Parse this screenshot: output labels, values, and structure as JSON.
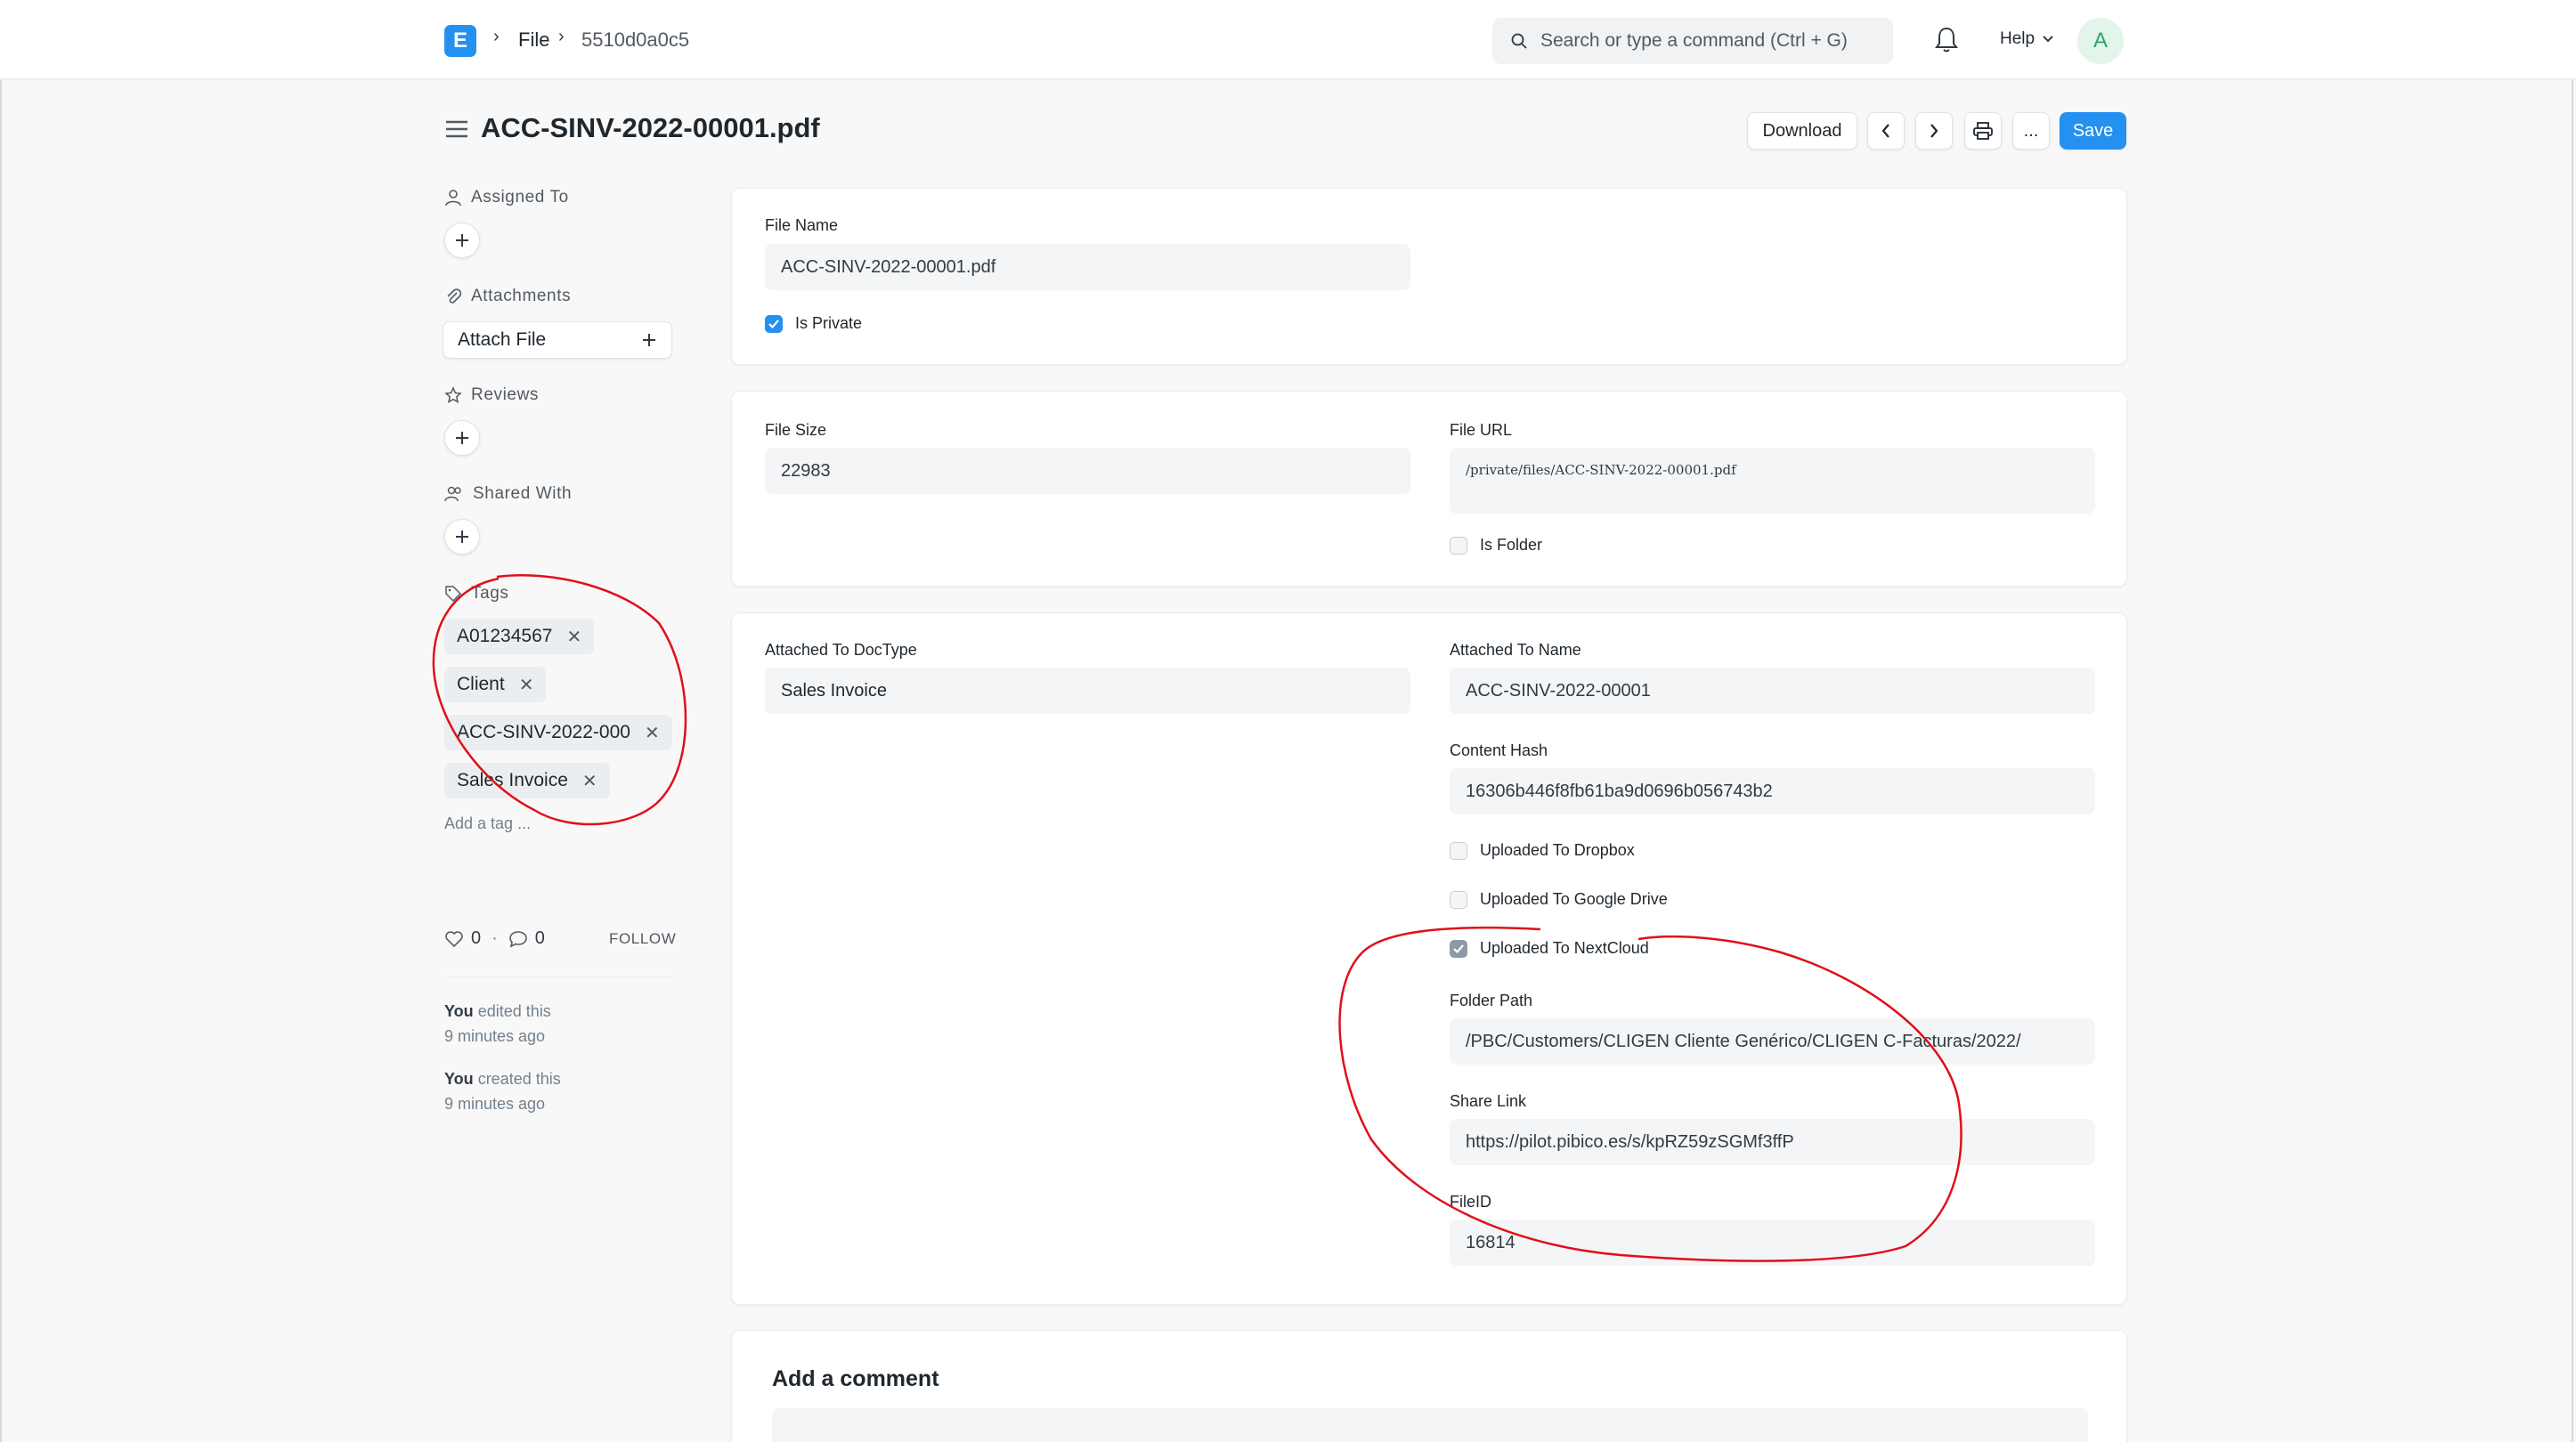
{
  "navbar": {
    "logo_letter": "E",
    "breadcrumbs": [
      "File",
      "5510d0a0c5"
    ],
    "search_placeholder": "Search or type a command (Ctrl + G)",
    "help_label": "Help",
    "avatar_initial": "A"
  },
  "page": {
    "title": "ACC-SINV-2022-00001.pdf",
    "actions": {
      "download_label": "Download",
      "more_label": "...",
      "save_label": "Save"
    }
  },
  "sidebar": {
    "assigned_to_label": "Assigned To",
    "attachments_label": "Attachments",
    "attach_file_label": "Attach File",
    "reviews_label": "Reviews",
    "shared_with_label": "Shared With",
    "tags_label": "Tags",
    "tags": [
      "A01234567",
      "Client",
      "ACC-SINV-2022-000",
      "Sales Invoice"
    ],
    "add_tag_placeholder": "Add a tag ...",
    "likes_count": "0",
    "comments_count": "0",
    "follow_label": "FOLLOW",
    "activity": [
      {
        "who": "You",
        "action": "edited this",
        "when": "9 minutes ago"
      },
      {
        "who": "You",
        "action": "created this",
        "when": "9 minutes ago"
      }
    ]
  },
  "form": {
    "file_name_label": "File Name",
    "file_name_value": "ACC-SINV-2022-00001.pdf",
    "is_private_label": "Is Private",
    "is_private_checked": true,
    "file_size_label": "File Size",
    "file_size_value": "22983",
    "file_url_label": "File URL",
    "file_url_value": "/private/files/ACC-SINV-2022-00001.pdf",
    "is_folder_label": "Is Folder",
    "is_folder_checked": false,
    "attached_to_doctype_label": "Attached To DocType",
    "attached_to_doctype_value": "Sales Invoice",
    "attached_to_name_label": "Attached To Name",
    "attached_to_name_value": "ACC-SINV-2022-00001",
    "content_hash_label": "Content Hash",
    "content_hash_value": "16306b446f8fb61ba9d0696b056743b2",
    "uploaded_dropbox_label": "Uploaded To Dropbox",
    "uploaded_dropbox_checked": false,
    "uploaded_gdrive_label": "Uploaded To Google Drive",
    "uploaded_gdrive_checked": false,
    "uploaded_nextcloud_label": "Uploaded To NextCloud",
    "uploaded_nextcloud_checked": true,
    "folder_path_label": "Folder Path",
    "folder_path_value": "/PBC/Customers/CLIGEN Cliente Genérico/CLIGEN C-Facturas/2022/",
    "share_link_label": "Share Link",
    "share_link_value": "https://pilot.pibico.es/s/kpRZ59zSGMf3ffP",
    "fileid_label": "FileID",
    "fileid_value": "16814"
  },
  "comments": {
    "title": "Add a comment"
  },
  "colors": {
    "accent": "#2490ef",
    "annotation": "#e0101a"
  }
}
